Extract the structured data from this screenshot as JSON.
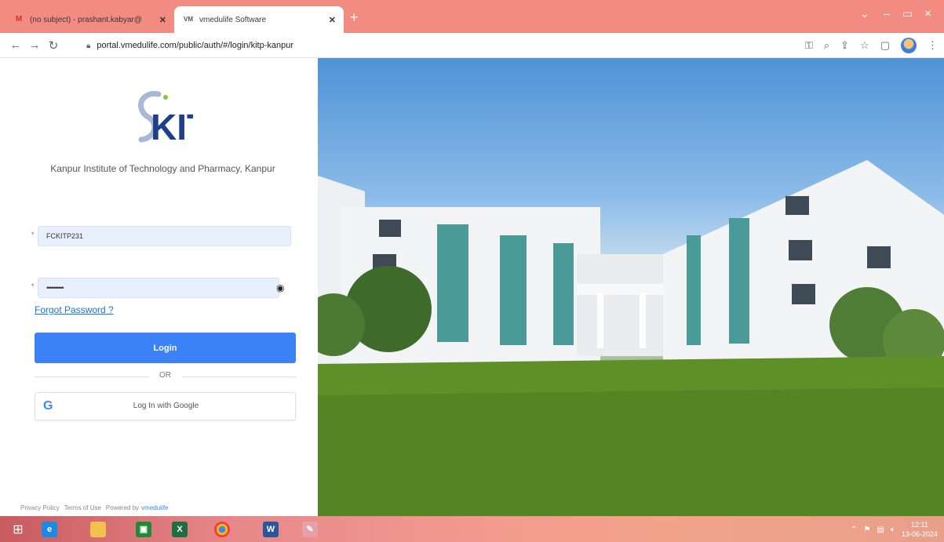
{
  "browser": {
    "tabs": [
      {
        "favicon": "gmail-icon",
        "title": "(no subject) - prashant.kabyar@",
        "active": false
      },
      {
        "favicon": "vmedulife-icon",
        "title": "vmedulife Software",
        "active": true
      }
    ],
    "url": "portal.vmedulife.com/public/auth/#/login/kitp-kanpur"
  },
  "login": {
    "logo_text": "KIT",
    "institute_name": "Kanpur Institute of Technology and Pharmacy, Kanpur",
    "username_value": "FCKITP231",
    "password_value": "••••••••••",
    "forgot_label": "Forgot Password ?",
    "login_label": "Login",
    "or_label": "OR",
    "google_label": "Log In with Google",
    "footer": {
      "privacy": "Privacy Policy",
      "terms": "Terms of Use",
      "powered": "Powered by",
      "brand": "vmedulife"
    }
  },
  "taskbar": {
    "time": "12:11",
    "date": "13-06-2024"
  },
  "colors": {
    "accent": "#3b82f6",
    "tabstrip": "#f28b82",
    "required": "#e53935"
  }
}
